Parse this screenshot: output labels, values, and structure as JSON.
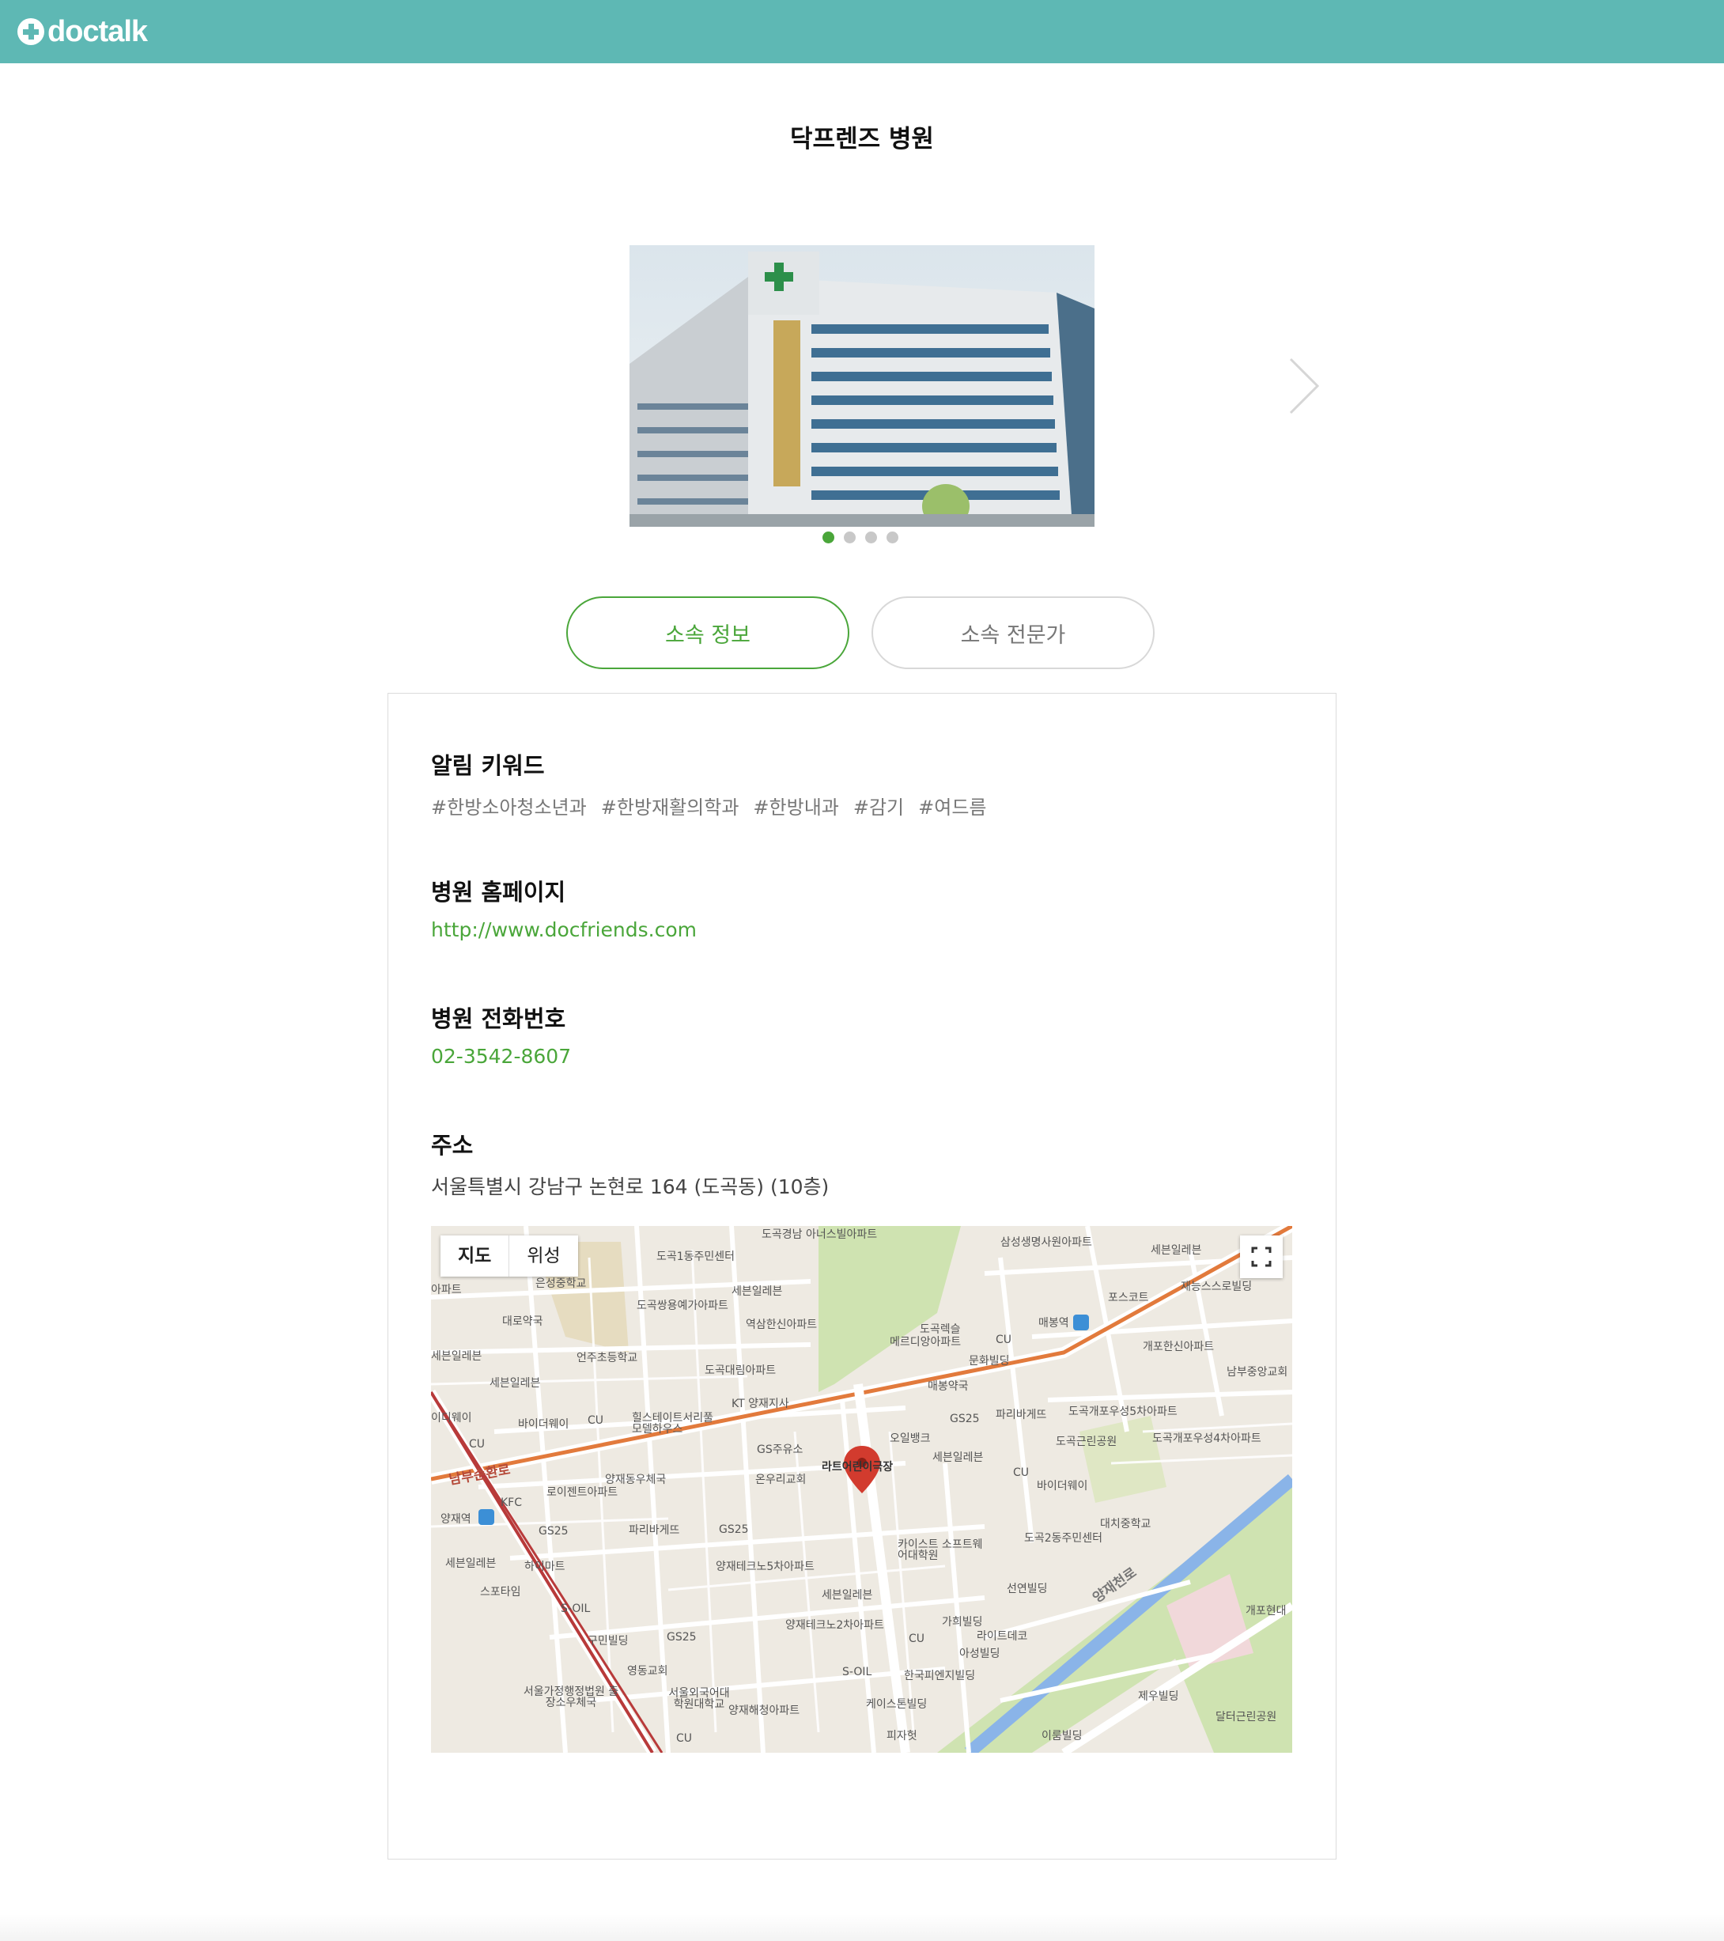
{
  "header": {
    "logo_text": "doctalk",
    "brand_color": "#5eb8b4"
  },
  "page": {
    "title": "닥프렌즈 병원"
  },
  "carousel": {
    "total": 4,
    "active_index": 0,
    "accent": "#4aa63a"
  },
  "tabs": [
    {
      "label": "소속 정보",
      "active": true
    },
    {
      "label": "소속 전문가",
      "active": false
    }
  ],
  "info": {
    "keywords_title": "알림 키워드",
    "keywords": [
      "#한방소아청소년과",
      "#한방재활의학과",
      "#한방내과",
      "#감기",
      "#여드름"
    ],
    "homepage_title": "병원 홈페이지",
    "homepage_url": "http://www.docfriends.com",
    "phone_title": "병원 전화번호",
    "phone": "02-3542-8607",
    "address_title": "주소",
    "address": "서울특별시 강남구 논현로 164 (도곡동) (10층)"
  },
  "map": {
    "toggle": {
      "map": "지도",
      "satellite": "위성"
    },
    "marker_label": "라트어린이극장",
    "labels": [
      "도곡경남 아너스빌아파트",
      "삼성생명사원아파트",
      "세븐일레븐",
      "도곡1동주민센터",
      "은성중학교",
      "세븐일레븐",
      "아파트",
      "도곡쌍용예가아파트",
      "대로약국",
      "역삼한신아파트",
      "도곡렉슬",
      "메르디앙아파트",
      "CU",
      "매봉역",
      "포스코트",
      "재능스스로빌딩",
      "세븐일레븐",
      "언주초등학교",
      "도곡대림아파트",
      "문화빌딩",
      "개포한신아파트",
      "남부중앙교회",
      "세븐일레븐",
      "KT 양재지사",
      "매봉약국",
      "이디웨이",
      "바이더웨이",
      "CU",
      "힐스테이트서리풀모델하우스",
      "GS25",
      "파리바게뜨",
      "도곡개포우성5차아파트",
      "CU",
      "오일뱅크",
      "도곡근린공원",
      "도곡개포우성4차아파트",
      "GS주유소",
      "세븐일레븐",
      "남부순환로",
      "양재동우체국",
      "온우리교회",
      "CU",
      "바이더웨이",
      "KFC",
      "로이젠트아파트",
      "대치중학교",
      "양재역",
      "파리바게뜨",
      "GS25",
      "도곡2동주민센터",
      "GS25",
      "카이스트 소프트웨어대학원",
      "양재천로",
      "세븐일레븐",
      "하이마트",
      "양재테크노5차아파트",
      "스포타임",
      "세븐일레븐",
      "선연빌딩",
      "S-OIL",
      "개포현대",
      "구민빌딩",
      "GS25",
      "양재테크노2차아파트",
      "가희빌딩",
      "CU",
      "라이트데코",
      "영동교회",
      "아성빌딩",
      "S-OIL",
      "한국피엔지빌딩",
      "서울가정행정법원 출장소우체국",
      "서울외국어대학원대학교",
      "양재해청아파트",
      "케이스톤빌딩",
      "제우빌딩",
      "달터근린공원",
      "CU",
      "피자헛",
      "이룸빌딩"
    ]
  }
}
